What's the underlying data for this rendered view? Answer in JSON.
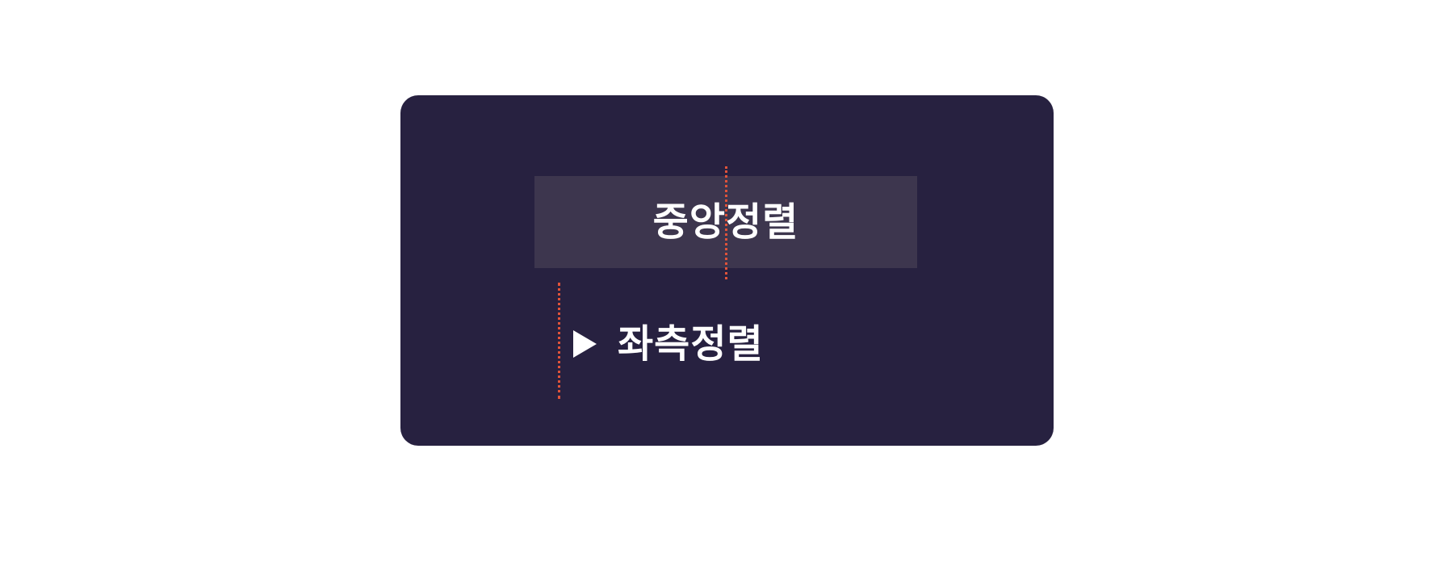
{
  "labels": {
    "center_aligned": "중앙정렬",
    "left_aligned": "좌측정렬"
  },
  "icons": {
    "left_marker": "play-triangle-icon"
  },
  "colors": {
    "background": "#ffffff",
    "card": "#272140",
    "center_box": "#3d364e",
    "text": "#ffffff",
    "guide_line": "#e0533a"
  }
}
